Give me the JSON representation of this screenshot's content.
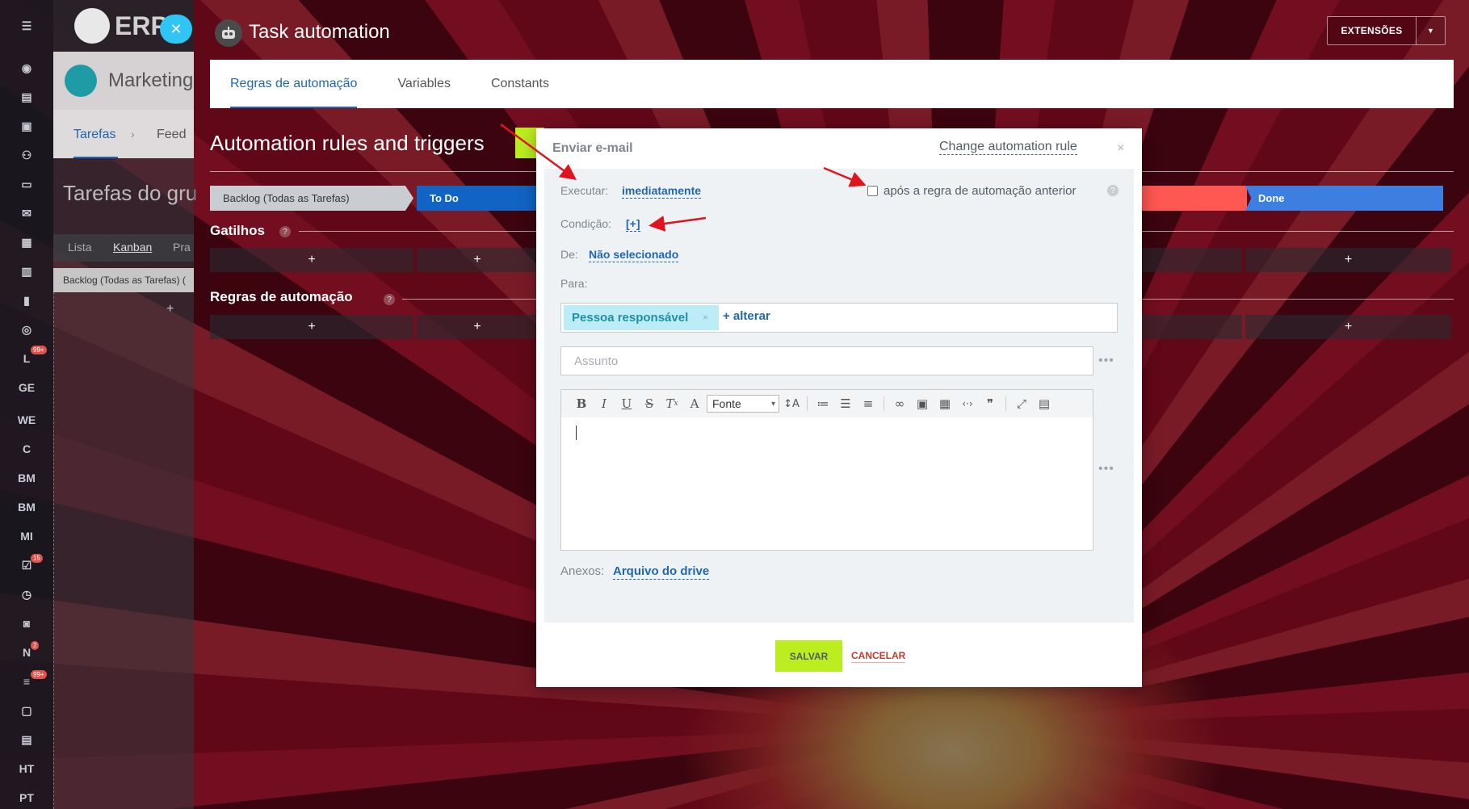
{
  "app": {
    "logo_text": "ERP",
    "page_title": "Marketing",
    "tabs": [
      "Tarefas",
      "Feed"
    ],
    "subtitle": "Tarefas do gru",
    "views": [
      "Lista",
      "Kanban",
      "Pra"
    ],
    "column_title": "Backlog (Todas as Tarefas) (",
    "sidebar_badges": [
      "99+",
      "15",
      "2",
      "99+"
    ],
    "sidebar_letters": [
      "L",
      "GE",
      "WE",
      "C",
      "BM",
      "BM",
      "MI",
      "N",
      "HT",
      "PT"
    ]
  },
  "panel": {
    "title": "Task automation",
    "extensions_label": "EXTENSÕES",
    "tabs": [
      "Regras de automação",
      "Variables",
      "Constants"
    ],
    "heading": "Automation rules and triggers",
    "stages": [
      "Backlog (Todas as Tarefas)",
      "To Do",
      "Done"
    ],
    "triggers_label": "Gatilhos",
    "rules_label": "Regras de automação",
    "plus": "+",
    "help": "?"
  },
  "modal": {
    "title": "Enviar e-mail",
    "change_rule": "Change automation rule",
    "close": "×",
    "execute_label": "Executar:",
    "execute_value": "imediatamente",
    "after_previous": "após a regra de automação anterior",
    "condition_label": "Condição:",
    "condition_value": "[+]",
    "from_label": "De:",
    "from_value": "Não selecionado",
    "to_label": "Para:",
    "recipient_chip": "Pessoa responsável",
    "chip_remove": "×",
    "alter_link": "+ alterar",
    "subject_placeholder": "Assunto",
    "font_select": "Fonte",
    "attachments_label": "Anexos:",
    "attachments_link": "Arquivo do drive",
    "save_label": "SALVAR",
    "cancel_label": "CANCELAR",
    "more": "•••"
  },
  "colors": {
    "accent": "#2067b0",
    "save_green": "#bbed21",
    "cancel_red": "#c43b2a",
    "annotation_arrow": "#e0141e"
  }
}
